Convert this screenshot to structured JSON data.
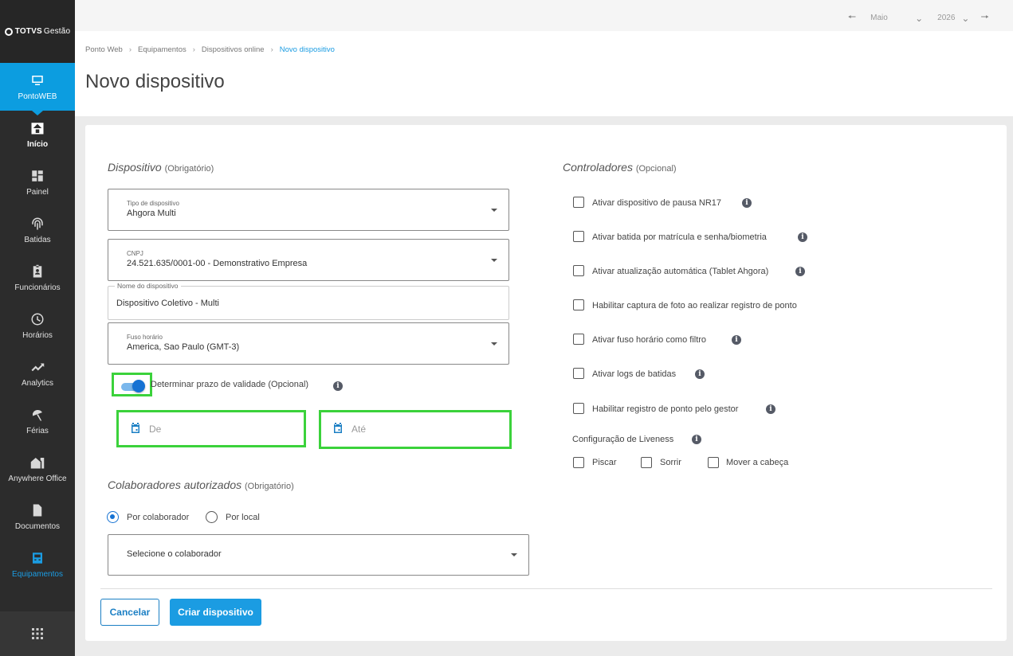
{
  "app": {
    "brand_bold": "TOTVS",
    "brand_light": "Gestão"
  },
  "sidebar": {
    "product": "PontoWEB",
    "items": [
      {
        "label": "Início",
        "icon": "home-icon"
      },
      {
        "label": "Painel",
        "icon": "dashboard-icon"
      },
      {
        "label": "Batidas",
        "icon": "fingerprint-icon"
      },
      {
        "label": "Funcionários",
        "icon": "badge-icon"
      },
      {
        "label": "Horários",
        "icon": "clock-icon"
      },
      {
        "label": "Analytics",
        "icon": "trending-icon"
      },
      {
        "label": "Férias",
        "icon": "beach-icon"
      },
      {
        "label": "Anywhere Office",
        "icon": "home-work-icon"
      },
      {
        "label": "Documentos",
        "icon": "document-icon"
      },
      {
        "label": "Equipamentos",
        "icon": "device-icon"
      }
    ]
  },
  "topbar": {
    "month": "Maio",
    "year": "2026"
  },
  "breadcrumb": [
    "Ponto Web",
    "Equipamentos",
    "Dispositivos online",
    "Novo dispositivo"
  ],
  "page_title": "Novo dispositivo",
  "dispositivo": {
    "title": "Dispositivo",
    "required": "(Obrigatório)",
    "tipo": {
      "label": "Tipo de dispositivo",
      "value": "Ahgora Multi"
    },
    "cnpj": {
      "label": "CNPJ",
      "value": "24.521.635/0001-00 - Demonstrativo Empresa"
    },
    "nome": {
      "label": "Nome do dispositivo",
      "value": "Dispositivo Coletivo - Multi"
    },
    "fuso": {
      "label": "Fuso horário",
      "value": "America, Sao Paulo (GMT-3)"
    },
    "validade_label": "Determinar prazo de validade (Opcional)",
    "de_placeholder": "De",
    "ate_placeholder": "Até"
  },
  "colaboradores": {
    "title": "Colaboradores autorizados",
    "required": "(Obrigatório)",
    "radio_colaborador": "Por colaborador",
    "radio_local": "Por local",
    "select_placeholder": "Selecione o colaborador"
  },
  "controladores": {
    "title": "Controladores",
    "optional": "(Opcional)",
    "items": [
      "Ativar dispositivo de pausa NR17",
      "Ativar batida por matrícula e senha/biometria",
      "Ativar atualização automática (Tablet Ahgora)",
      "Habilitar captura de foto ao realizar registro de ponto",
      "Ativar fuso horário como filtro",
      "Ativar logs de batidas",
      "Habilitar registro de ponto pelo gestor"
    ],
    "liveness_label": "Configuração de Liveness",
    "liveness_options": [
      "Piscar",
      "Sorrir",
      "Mover a cabeça"
    ]
  },
  "actions": {
    "cancel": "Cancelar",
    "create": "Criar dispositivo"
  },
  "colors": {
    "accent": "#1b9ce2",
    "highlight": "#3bd23b",
    "sidebar": "#2c2c2c"
  }
}
